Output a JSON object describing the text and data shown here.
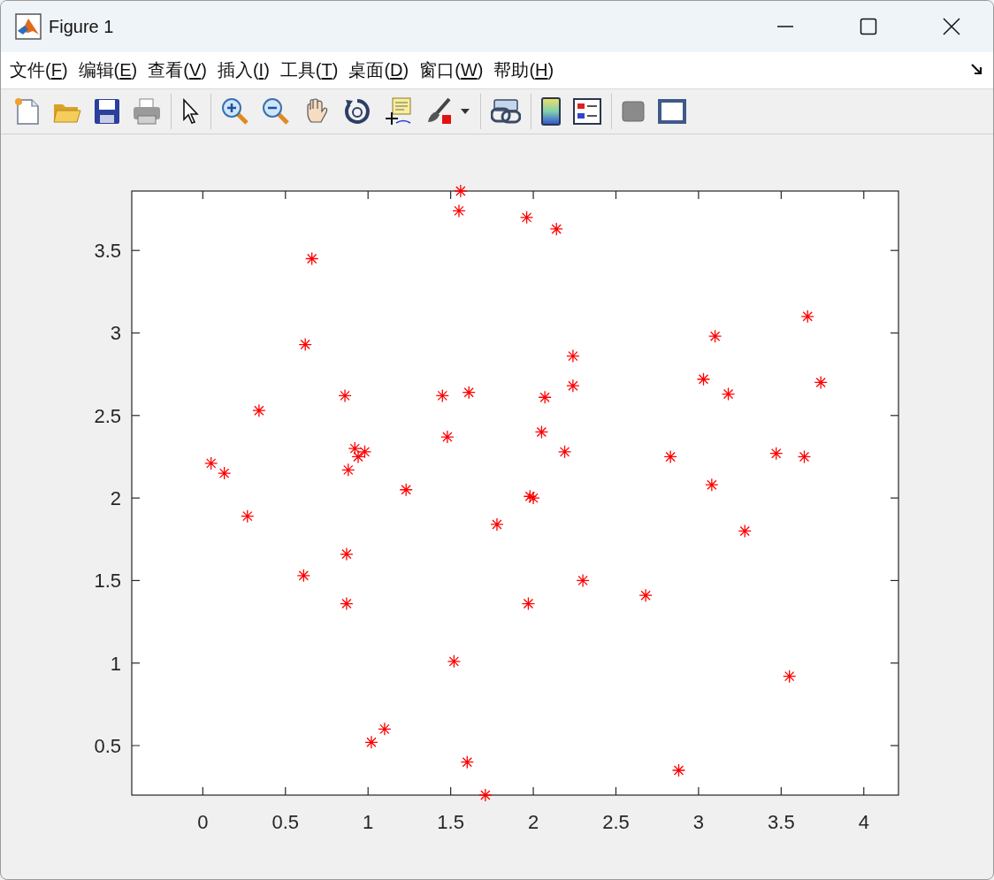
{
  "window": {
    "title": "Figure 1"
  },
  "menu": [
    {
      "before": "文件(",
      "mnemonic": "F",
      "after": ")"
    },
    {
      "before": "编辑(",
      "mnemonic": "E",
      "after": ")"
    },
    {
      "before": "查看(",
      "mnemonic": "V",
      "after": ")"
    },
    {
      "before": "插入(",
      "mnemonic": "I",
      "after": ")"
    },
    {
      "before": "工具(",
      "mnemonic": "T",
      "after": ")"
    },
    {
      "before": "桌面(",
      "mnemonic": "D",
      "after": ")"
    },
    {
      "before": "窗口(",
      "mnemonic": "W",
      "after": ")"
    },
    {
      "before": "帮助(",
      "mnemonic": "H",
      "after": ")"
    }
  ],
  "figure": {
    "chart_data": {
      "type": "scatter",
      "xlim": [
        -0.43,
        4.21
      ],
      "ylim": [
        0.2,
        3.86
      ],
      "xticks": [
        0,
        0.5,
        1,
        1.5,
        2,
        2.5,
        3,
        3.5,
        4
      ],
      "yticks": [
        0.5,
        1,
        1.5,
        2,
        2.5,
        3,
        3.5
      ],
      "x": [
        1.56,
        1.55,
        1.96,
        2.14,
        0.66,
        3.66,
        3.1,
        0.62,
        2.24,
        3.74,
        3.03,
        2.24,
        1.61,
        3.18,
        0.86,
        1.45,
        2.07,
        0.34,
        2.05,
        1.48,
        0.92,
        0.98,
        0.94,
        2.19,
        2.83,
        3.47,
        3.64,
        0.05,
        0.13,
        0.88,
        1.23,
        1.98,
        2.0,
        3.08,
        0.27,
        1.78,
        3.28,
        0.87,
        0.61,
        2.3,
        2.68,
        0.87,
        1.97,
        1.52,
        3.55,
        1.1,
        1.02,
        1.6,
        2.88,
        1.71
      ],
      "series": [
        {
          "color": "#ff0000",
          "values": [
            3.86,
            3.74,
            3.7,
            3.63,
            3.45,
            3.1,
            2.98,
            2.93,
            2.86,
            2.7,
            2.72,
            2.68,
            2.64,
            2.63,
            2.62,
            2.62,
            2.61,
            2.53,
            2.4,
            2.37,
            2.3,
            2.28,
            2.25,
            2.28,
            2.25,
            2.27,
            2.25,
            2.21,
            2.15,
            2.17,
            2.05,
            2.01,
            2.0,
            2.08,
            1.89,
            1.84,
            1.8,
            1.66,
            1.53,
            1.5,
            1.41,
            1.36,
            1.36,
            1.01,
            0.92,
            0.6,
            0.52,
            0.4,
            0.35,
            0.2
          ]
        }
      ]
    }
  }
}
